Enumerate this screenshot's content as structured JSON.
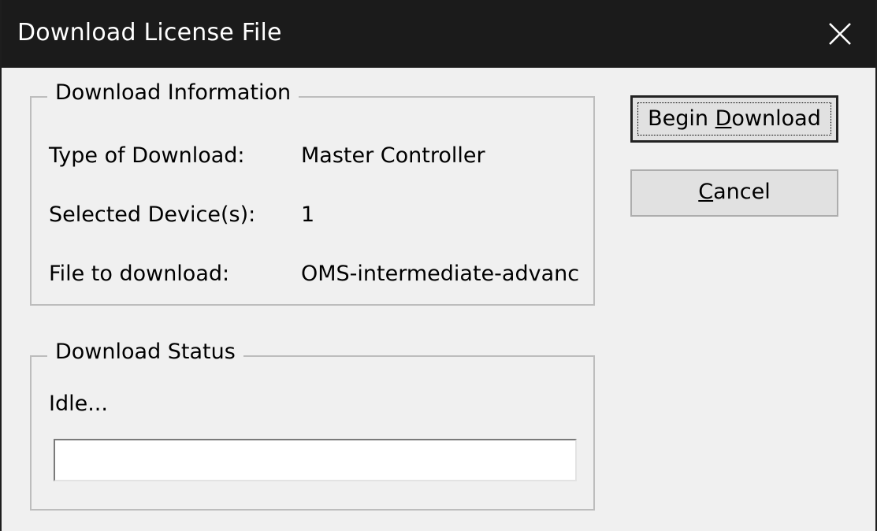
{
  "window": {
    "title": "Download License File",
    "close_icon": "close-icon"
  },
  "info_group": {
    "legend": "Download Information",
    "rows": [
      {
        "label": "Type of Download:",
        "value": "Master Controller"
      },
      {
        "label": "Selected Device(s):",
        "value": "1"
      },
      {
        "label": "File to download:",
        "value": "OMS-intermediate-advanc"
      }
    ]
  },
  "status_group": {
    "legend": "Download Status",
    "status": "Idle...",
    "progress": 0
  },
  "buttons": {
    "begin": {
      "prefix": "Begin ",
      "accel": "D",
      "suffix": "ownload"
    },
    "cancel": {
      "prefix": "",
      "accel": "C",
      "suffix": "ancel"
    }
  },
  "colors": {
    "titlebar": "#1b1b1b",
    "dialog_bg": "#f0f0f0",
    "progress_fill": "#06b025"
  }
}
